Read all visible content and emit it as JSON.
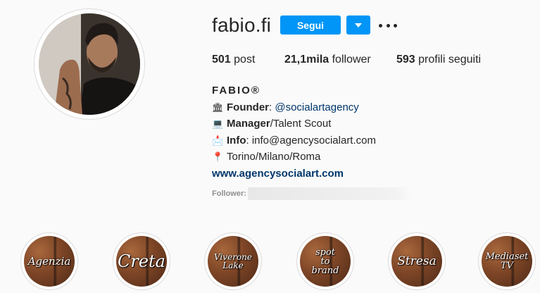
{
  "profile": {
    "username": "fabio.fi",
    "follow_label": "Segui",
    "avatar_icon": "profile-photo",
    "more_icon": "more-dots-icon"
  },
  "stats": {
    "posts_value": "501",
    "posts_label": "post",
    "followers_value": "21,1mila",
    "followers_label": "follower",
    "following_value": "593",
    "following_label": "profili seguiti"
  },
  "bio": {
    "full_name": "FABIO®",
    "lines": [
      {
        "emoji": "🏛",
        "bold": "Founder",
        "after_bold": ": ",
        "text": "",
        "link": "@socialartagency"
      },
      {
        "emoji": "💻",
        "bold": "Manager",
        "after_bold": "",
        "text": "/Talent Scout",
        "link": ""
      },
      {
        "emoji": "📩",
        "bold": "Info",
        "after_bold": ": ",
        "text": "info@agencysocialart.com",
        "link": ""
      },
      {
        "emoji": "📍",
        "bold": "",
        "after_bold": "",
        "text": "Torino/Milano/Roma",
        "link": ""
      }
    ],
    "website": "www.agencysocialart.com"
  },
  "followed_by": {
    "label": "Follower:"
  },
  "highlights": [
    {
      "title": "Agenzia",
      "size": 15
    },
    {
      "title": "Creta",
      "size": 24
    },
    {
      "title": "Viverone\nLake",
      "size": 12
    },
    {
      "title": "spot\nto\nbrand",
      "size": 13
    },
    {
      "title": "Stresa",
      "size": 17
    },
    {
      "title": "Mediaset\nTV",
      "size": 13
    }
  ]
}
